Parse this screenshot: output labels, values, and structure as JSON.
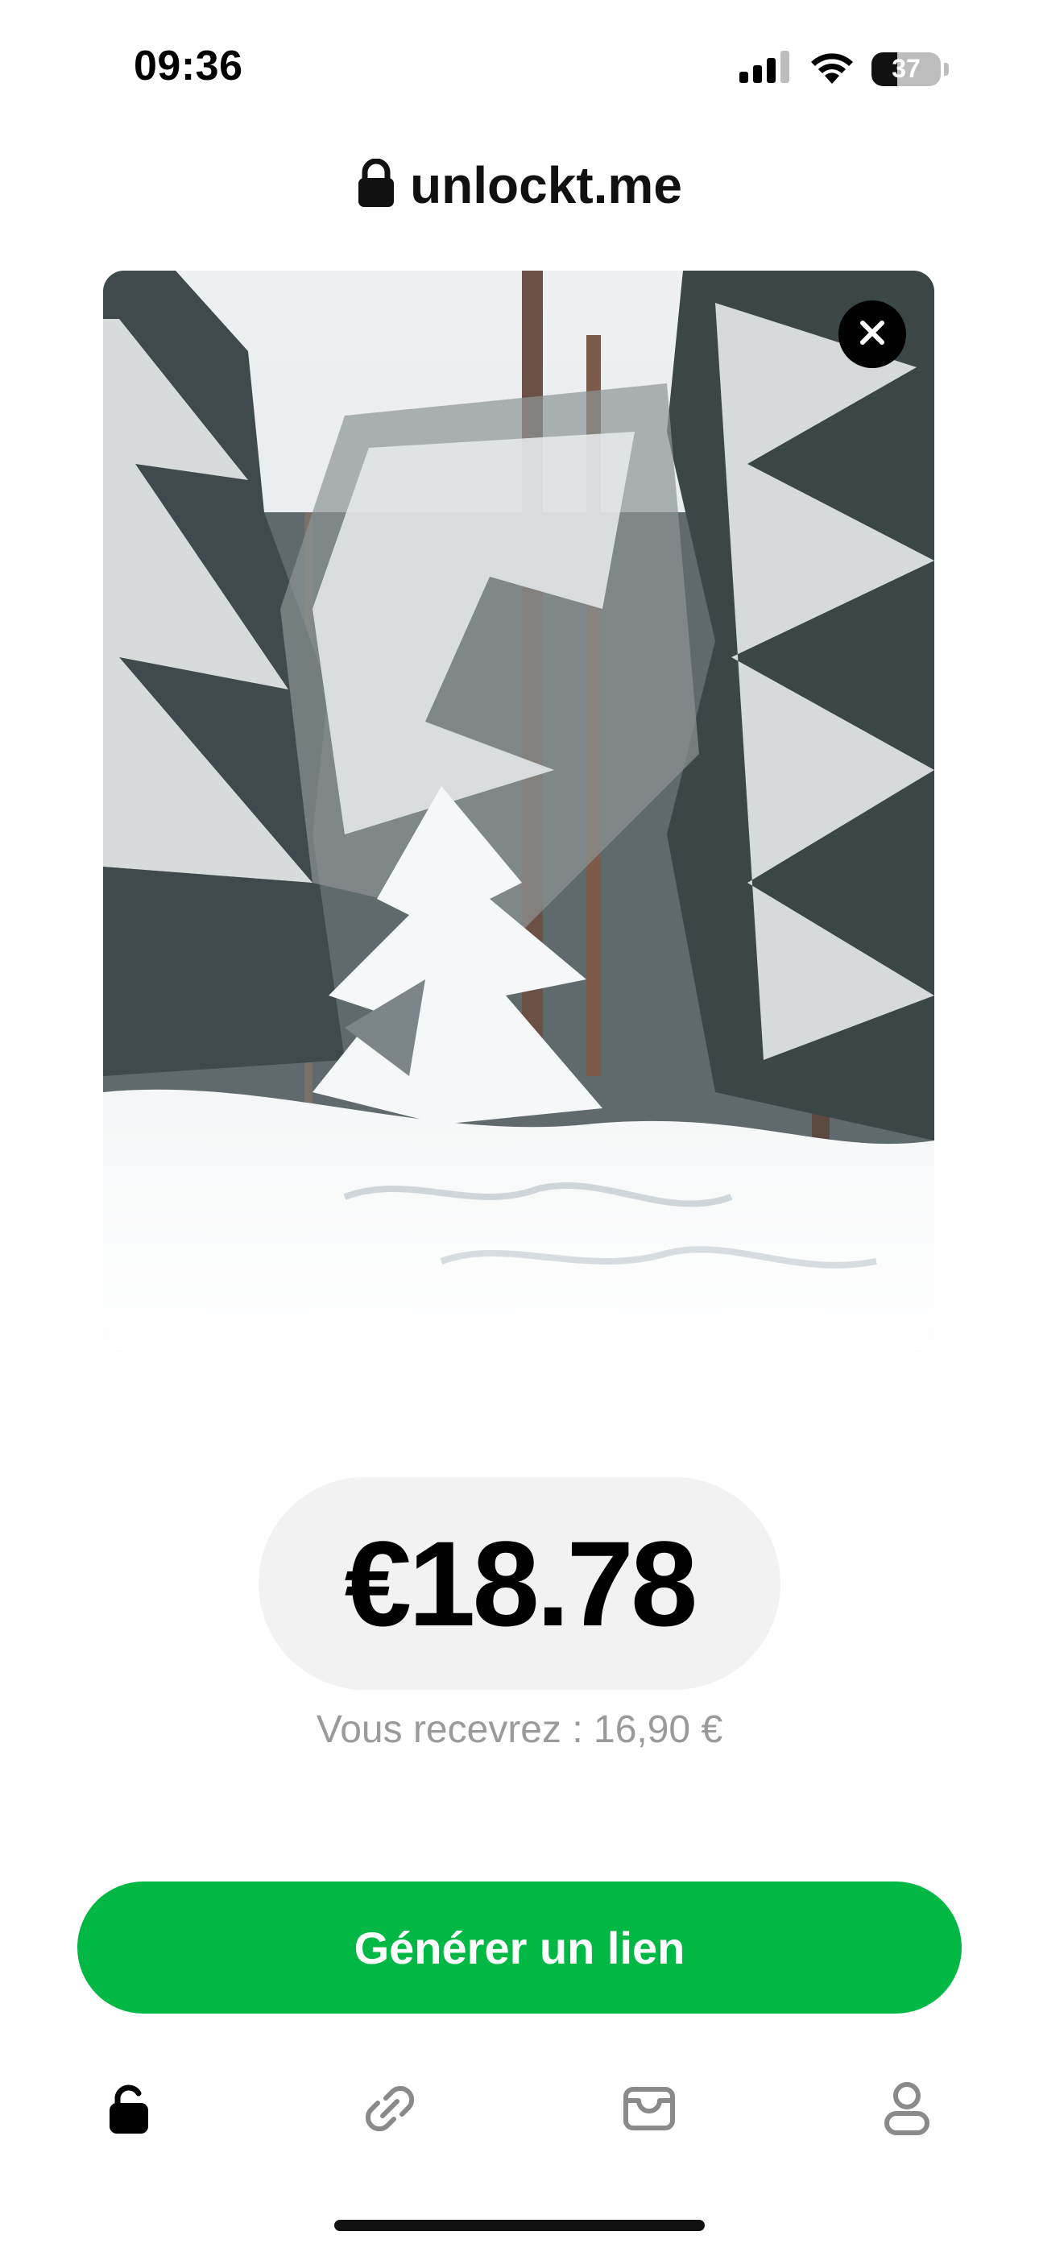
{
  "status_bar": {
    "time": "09:36",
    "battery_level": "37",
    "icons": [
      "cellular-signal-icon",
      "wifi-icon",
      "battery-icon"
    ]
  },
  "header": {
    "brand": "unlockt.me",
    "icon": "lock-icon"
  },
  "media": {
    "close_icon": "close-icon"
  },
  "pricing": {
    "price": "€18.78",
    "receive_text": "Vous recevrez : 16,90 €"
  },
  "cta": {
    "label": "Générer un lien",
    "color": "#00b843"
  },
  "tabbar": {
    "items": [
      {
        "icon": "lock-icon",
        "active": true
      },
      {
        "icon": "link-icon",
        "active": false
      },
      {
        "icon": "wallet-icon",
        "active": false
      },
      {
        "icon": "profile-icon",
        "active": false
      }
    ]
  }
}
